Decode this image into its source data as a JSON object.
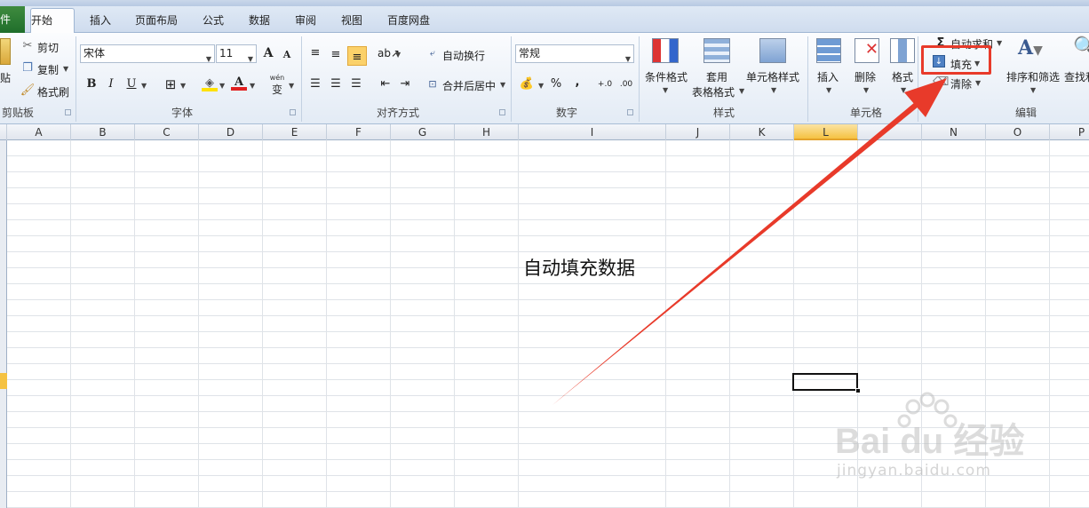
{
  "tabs": {
    "file": "件",
    "home": "开始",
    "insert": "插入",
    "layout": "页面布局",
    "formulas": "公式",
    "data": "数据",
    "review": "审阅",
    "view": "视图",
    "baidu": "百度网盘"
  },
  "clipboard": {
    "paste": "贴",
    "cut": "剪切",
    "copy": "复制",
    "format_painter": "格式刷",
    "group_label": "剪贴板"
  },
  "font": {
    "name": "宋体",
    "size": "11",
    "bold": "B",
    "italic": "I",
    "underline": "U",
    "grow": "A",
    "shrink": "A",
    "font_color_glyph": "A",
    "phonetic": "wén",
    "phonetic2": "变",
    "group_label": "字体"
  },
  "alignment": {
    "wrap": "自动换行",
    "merge": "合并后居中",
    "group_label": "对齐方式"
  },
  "number": {
    "format": "常规",
    "percent": "%",
    "comma": ",",
    "group_label": "数字"
  },
  "styles": {
    "conditional": "条件格式",
    "table1": "套用",
    "table2": "表格格式",
    "cell_styles": "单元格样式",
    "group_label": "样式"
  },
  "cells": {
    "insert": "插入",
    "delete": "删除",
    "format": "格式",
    "group_label": "单元格"
  },
  "editing": {
    "autosum": "自动求和",
    "fill": "填充",
    "clear": "清除",
    "sort": "排序和筛选",
    "find": "查找和",
    "group_label": "编辑"
  },
  "columns": [
    "A",
    "B",
    "C",
    "D",
    "E",
    "F",
    "G",
    "H",
    "I",
    "J",
    "K",
    "L",
    "N",
    "O",
    "P"
  ],
  "sheet": {
    "cell_text": "自动填充数据",
    "selected_column": "L"
  },
  "watermark": {
    "brand": "Bai du 经验",
    "url": "jingyan.baidu.com"
  },
  "colors": {
    "accent_red": "#e83a2a",
    "selection_orange": "#f5c242"
  }
}
